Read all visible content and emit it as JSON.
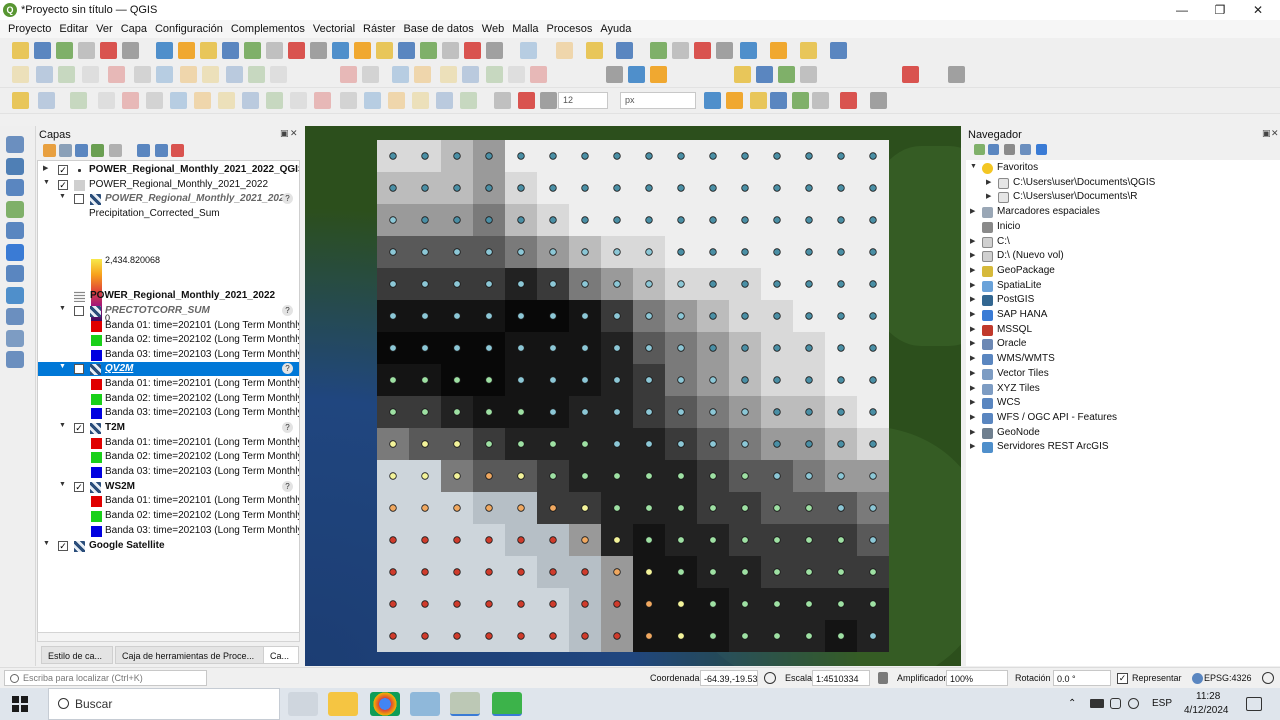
{
  "window": {
    "title": "*Proyecto sin título — QGIS",
    "minimize": "—",
    "maximize": "❐",
    "close": "✕",
    "app_icon_letter": "Q"
  },
  "menus": [
    "Proyecto",
    "Editar",
    "Ver",
    "Capa",
    "Configuración",
    "Complementos",
    "Vectorial",
    "Ráster",
    "Base de datos",
    "Web",
    "Malla",
    "Procesos",
    "Ayuda"
  ],
  "snapping": {
    "tolerance": "12",
    "unit": "px"
  },
  "layers_panel": {
    "title": "Capas",
    "legend_max": "2,434.820068",
    "legend_min": "0",
    "rows": [
      {
        "label": "POWER_Regional_Monthly_2021_2022_QGIS",
        "bold": true,
        "checked": true
      },
      {
        "label": "POWER_Regional_Monthly_2021_2022",
        "bold": false,
        "checked": true
      },
      {
        "label": "POWER_Regional_Monthly_2021_2022",
        "bold": true,
        "italic": true,
        "checked": false
      },
      {
        "label": "Precipitation_Corrected_Sum"
      },
      {
        "label": "POWER_Regional_Monthly_2021_2022",
        "bold": true
      },
      {
        "label": "PRECTOTCORR_SUM",
        "bold": true,
        "italic": true,
        "checked": false
      },
      {
        "label": "Banda 01: time=202101 (Long Term Monthly"
      },
      {
        "label": "Banda 02: time=202102 (Long Term Monthly"
      },
      {
        "label": "Banda 03: time=202103 (Long Term Monthly"
      },
      {
        "label": "QV2M",
        "bold": true,
        "italic": true,
        "checked": false,
        "selected": true
      },
      {
        "label": "Banda 01: time=202101 (Long Term Monthly"
      },
      {
        "label": "Banda 02: time=202102 (Long Term Monthly"
      },
      {
        "label": "Banda 03: time=202103 (Long Term Monthly"
      },
      {
        "label": "T2M",
        "bold": true,
        "checked": true
      },
      {
        "label": "Banda 01: time=202101 (Long Term Monthly"
      },
      {
        "label": "Banda 02: time=202102 (Long Term Monthly"
      },
      {
        "label": "Banda 03: time=202103 (Long Term Monthly"
      },
      {
        "label": "WS2M",
        "bold": true,
        "checked": true
      },
      {
        "label": "Banda 01: time=202101 (Long Term Monthly"
      },
      {
        "label": "Banda 02: time=202102 (Long Term Monthly"
      },
      {
        "label": "Banda 03: time=202103 (Long Term Monthly"
      },
      {
        "label": "Google Satellite",
        "bold": true,
        "checked": true
      }
    ],
    "band_colors": [
      "#e00000",
      "#19d019",
      "#0000e0"
    ],
    "help_glyph": "?",
    "check_glyph": "✓",
    "tabs": [
      "Estilo de ca...",
      "Caja de herramientas de Proce...",
      "Ca..."
    ]
  },
  "navigator": {
    "title": "Navegador",
    "items": [
      {
        "label": "Favoritos",
        "icon": "star-icon",
        "color": "#f3c623",
        "expanded": true
      },
      {
        "label": "C:\\Users\\user\\Documents\\QGIS",
        "icon": "folder-icon",
        "color": "#e6e6e6"
      },
      {
        "label": "C:\\Users\\user\\Documents\\R",
        "icon": "folder-icon",
        "color": "#e6e6e6"
      },
      {
        "label": "Marcadores espaciales",
        "icon": "bookmark-icon",
        "color": "#9aa7b6"
      },
      {
        "label": "Inicio",
        "icon": "home-icon",
        "color": "#8a8a8a"
      },
      {
        "label": "C:\\",
        "icon": "drive-icon",
        "color": "#d0d0d0"
      },
      {
        "label": "D:\\ (Nuevo vol)",
        "icon": "drive-icon",
        "color": "#d0d0d0"
      },
      {
        "label": "GeoPackage",
        "icon": "geopackage-icon",
        "color": "#d6b93a"
      },
      {
        "label": "SpatiaLite",
        "icon": "spatialite-icon",
        "color": "#6aa2d9"
      },
      {
        "label": "PostGIS",
        "icon": "postgis-icon",
        "color": "#336791"
      },
      {
        "label": "SAP HANA",
        "icon": "saphana-icon",
        "color": "#3a7bd5"
      },
      {
        "label": "MSSQL",
        "icon": "mssql-icon",
        "color": "#c0392b"
      },
      {
        "label": "Oracle",
        "icon": "oracle-icon",
        "color": "#6c88b4"
      },
      {
        "label": "WMS/WMTS",
        "icon": "globe-icon",
        "color": "#5a86c0"
      },
      {
        "label": "Vector Tiles",
        "icon": "vector-tiles-icon",
        "color": "#7d9cc3"
      },
      {
        "label": "XYZ Tiles",
        "icon": "xyz-tiles-icon",
        "color": "#7d9cc3"
      },
      {
        "label": "WCS",
        "icon": "globe-icon",
        "color": "#5a86c0"
      },
      {
        "label": "WFS / OGC API - Features",
        "icon": "globe-icon",
        "color": "#5a86c0"
      },
      {
        "label": "GeoNode",
        "icon": "geonode-icon",
        "color": "#6f7f8f"
      },
      {
        "label": "Servidores REST ArcGIS",
        "icon": "arcgis-icon",
        "color": "#4f8fcb"
      }
    ]
  },
  "statusbar": {
    "search_placeholder": "Escriba para localizar (Ctrl+K)",
    "coord_label": "Coordenada",
    "coord_value": "-64.39,-19.53",
    "scale_label": "Escala",
    "scale_value": "1:4510334",
    "magnifier_label": "Amplificador",
    "magnifier_value": "100%",
    "rotation_label": "Rotación",
    "rotation_value": "0.0 °",
    "render_label": "Representar",
    "crs": "EPSG:4326"
  },
  "taskbar": {
    "search_label": "Buscar",
    "language": "ESP",
    "time": "11:28",
    "date": "4/12/2024"
  },
  "colors": {
    "selection": "#0078d7",
    "qgis_green": "#589632"
  },
  "raster_grid": {
    "rows": 16,
    "cols": 16,
    "shade_levels": [
      "eeeeee",
      "d9d9d9",
      "bcbcbc",
      "9a9a9a",
      "7a7a7a",
      "595959",
      "3a3a3a",
      "222222",
      "141414",
      "080808",
      "cdd5db",
      "b6bfc6",
      "999999"
    ],
    "shade_index": [
      [
        1,
        1,
        2,
        3,
        0,
        0,
        0,
        0,
        0,
        0,
        0,
        0,
        0,
        0,
        0,
        0
      ],
      [
        2,
        2,
        2,
        3,
        1,
        0,
        0,
        0,
        0,
        0,
        0,
        0,
        0,
        0,
        0,
        0
      ],
      [
        3,
        3,
        3,
        4,
        2,
        1,
        0,
        0,
        0,
        0,
        0,
        0,
        0,
        0,
        0,
        0
      ],
      [
        5,
        5,
        5,
        5,
        4,
        3,
        2,
        1,
        1,
        0,
        0,
        0,
        0,
        0,
        0,
        0
      ],
      [
        6,
        6,
        6,
        6,
        7,
        6,
        4,
        3,
        2,
        1,
        1,
        1,
        0,
        0,
        0,
        0
      ],
      [
        8,
        8,
        8,
        8,
        9,
        9,
        8,
        6,
        4,
        3,
        2,
        1,
        1,
        0,
        0,
        0
      ],
      [
        9,
        9,
        9,
        9,
        8,
        8,
        8,
        7,
        5,
        4,
        3,
        2,
        1,
        1,
        0,
        0
      ],
      [
        8,
        8,
        9,
        9,
        8,
        8,
        8,
        7,
        6,
        4,
        3,
        2,
        1,
        1,
        0,
        0
      ],
      [
        6,
        6,
        7,
        8,
        8,
        8,
        7,
        7,
        6,
        5,
        4,
        3,
        2,
        2,
        1,
        0
      ],
      [
        4,
        5,
        5,
        6,
        7,
        7,
        7,
        7,
        7,
        6,
        5,
        4,
        3,
        3,
        2,
        1
      ],
      [
        10,
        10,
        4,
        5,
        5,
        6,
        7,
        7,
        7,
        7,
        6,
        5,
        5,
        4,
        3,
        3
      ],
      [
        10,
        10,
        10,
        11,
        11,
        6,
        6,
        7,
        7,
        7,
        6,
        6,
        5,
        5,
        5,
        4
      ],
      [
        10,
        10,
        10,
        10,
        11,
        11,
        12,
        7,
        8,
        7,
        7,
        6,
        6,
        6,
        6,
        5
      ],
      [
        10,
        10,
        10,
        10,
        10,
        11,
        11,
        12,
        8,
        8,
        7,
        7,
        6,
        6,
        6,
        6
      ],
      [
        10,
        10,
        10,
        10,
        10,
        10,
        11,
        12,
        8,
        8,
        8,
        7,
        7,
        7,
        7,
        7
      ],
      [
        10,
        10,
        10,
        10,
        10,
        10,
        11,
        12,
        8,
        8,
        8,
        7,
        7,
        7,
        8,
        7
      ]
    ],
    "point_palette": [
      "#4a8fa5",
      "#8cc7d6",
      "#9ee0a3",
      "#f3f39a",
      "#f0a860",
      "#cf3b2b"
    ],
    "point_index": [
      [
        0,
        0,
        0,
        0,
        0,
        0,
        0,
        0,
        0,
        0,
        0,
        0,
        0,
        0,
        0,
        0
      ],
      [
        0,
        0,
        0,
        0,
        0,
        0,
        0,
        0,
        0,
        0,
        0,
        0,
        0,
        0,
        0,
        0
      ],
      [
        1,
        0,
        0,
        0,
        0,
        0,
        0,
        0,
        0,
        0,
        0,
        0,
        0,
        0,
        0,
        0
      ],
      [
        1,
        1,
        1,
        1,
        1,
        1,
        1,
        1,
        1,
        0,
        0,
        0,
        0,
        0,
        0,
        0
      ],
      [
        1,
        1,
        1,
        1,
        1,
        1,
        1,
        1,
        1,
        1,
        0,
        0,
        0,
        0,
        0,
        0
      ],
      [
        1,
        1,
        1,
        1,
        1,
        1,
        1,
        1,
        1,
        1,
        0,
        0,
        0,
        0,
        0,
        0
      ],
      [
        1,
        1,
        1,
        1,
        1,
        1,
        1,
        1,
        1,
        1,
        0,
        0,
        0,
        0,
        0,
        0
      ],
      [
        2,
        2,
        2,
        2,
        1,
        1,
        1,
        1,
        1,
        1,
        1,
        0,
        0,
        0,
        0,
        0
      ],
      [
        2,
        2,
        2,
        2,
        2,
        1,
        1,
        1,
        1,
        1,
        1,
        1,
        0,
        0,
        0,
        0
      ],
      [
        3,
        3,
        3,
        2,
        2,
        2,
        2,
        1,
        1,
        1,
        1,
        1,
        0,
        0,
        0,
        0
      ],
      [
        3,
        3,
        3,
        4,
        3,
        2,
        2,
        2,
        2,
        2,
        2,
        2,
        1,
        1,
        1,
        1
      ],
      [
        4,
        4,
        4,
        4,
        4,
        4,
        3,
        2,
        2,
        2,
        2,
        2,
        2,
        2,
        1,
        1
      ],
      [
        5,
        5,
        5,
        5,
        5,
        5,
        4,
        3,
        2,
        2,
        2,
        2,
        2,
        2,
        2,
        1
      ],
      [
        5,
        5,
        5,
        5,
        5,
        5,
        5,
        4,
        3,
        2,
        2,
        2,
        2,
        2,
        2,
        2
      ],
      [
        5,
        5,
        5,
        5,
        5,
        5,
        5,
        5,
        4,
        3,
        2,
        2,
        2,
        2,
        2,
        2
      ],
      [
        5,
        5,
        5,
        5,
        5,
        5,
        5,
        5,
        4,
        3,
        2,
        2,
        2,
        2,
        2,
        1
      ]
    ]
  }
}
